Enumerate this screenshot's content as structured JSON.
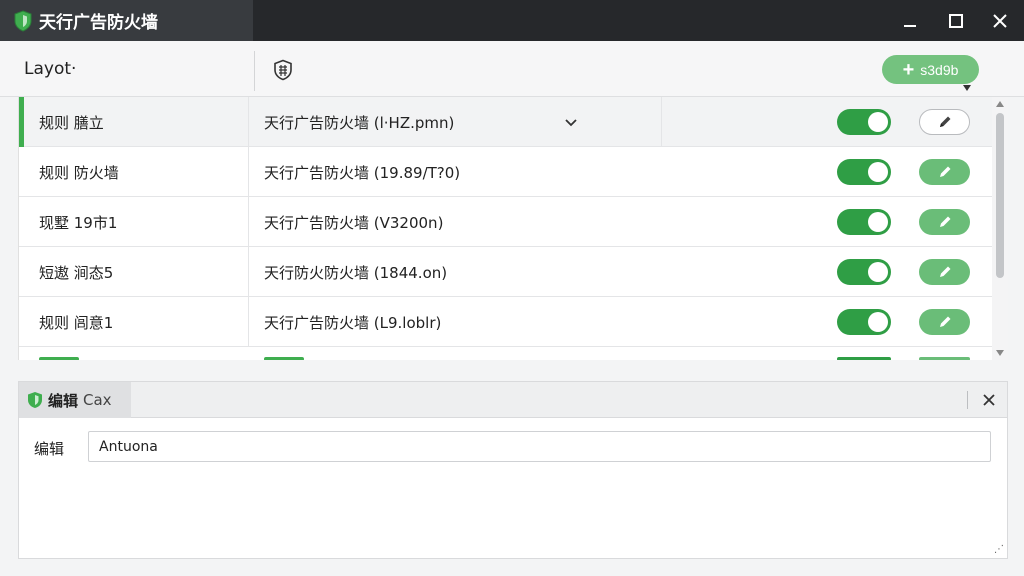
{
  "window": {
    "title": "天行广告防火墙",
    "controls": {
      "minimize": "minimize-icon",
      "maximize": "maximize-icon",
      "close": "close-icon"
    }
  },
  "toolbar": {
    "layout_label": "Layot·",
    "add_button_label": "s3d9b",
    "add_button_icon": "plus-icon",
    "shield_icon": "shield-grid-icon"
  },
  "rules": [
    {
      "name": "规则 膳立",
      "description": "天行广告防火墙 (l·HZ.pmn)",
      "enabled": true,
      "selected": true,
      "has_dropdown": true,
      "edit_style": "outline"
    },
    {
      "name": "规则 防火墙",
      "description": "天行广告防火墙 (19.89/T?0)",
      "enabled": true,
      "selected": false,
      "has_dropdown": false,
      "edit_style": "filled"
    },
    {
      "name": "现墅 19市1",
      "description": "天行广告防火墙 (V3200n)",
      "enabled": true,
      "selected": false,
      "has_dropdown": false,
      "edit_style": "filled"
    },
    {
      "name": "短遨 涧态5",
      "description": "天行防火防火墙 (1844.on)",
      "enabled": true,
      "selected": false,
      "has_dropdown": false,
      "edit_style": "filled"
    },
    {
      "name": "规则 闾意1",
      "description": "天行广告防火墙 (L9.loblr)",
      "enabled": true,
      "selected": false,
      "has_dropdown": false,
      "edit_style": "filled"
    }
  ],
  "edit_pane": {
    "tab_label": "编辑",
    "tab_sub": "Cax",
    "field_label": "编辑",
    "field_value": "Antuona"
  },
  "colors": {
    "titlebar": "#26282b",
    "accent_green": "#2f9e45",
    "button_green": "#6abd78"
  }
}
